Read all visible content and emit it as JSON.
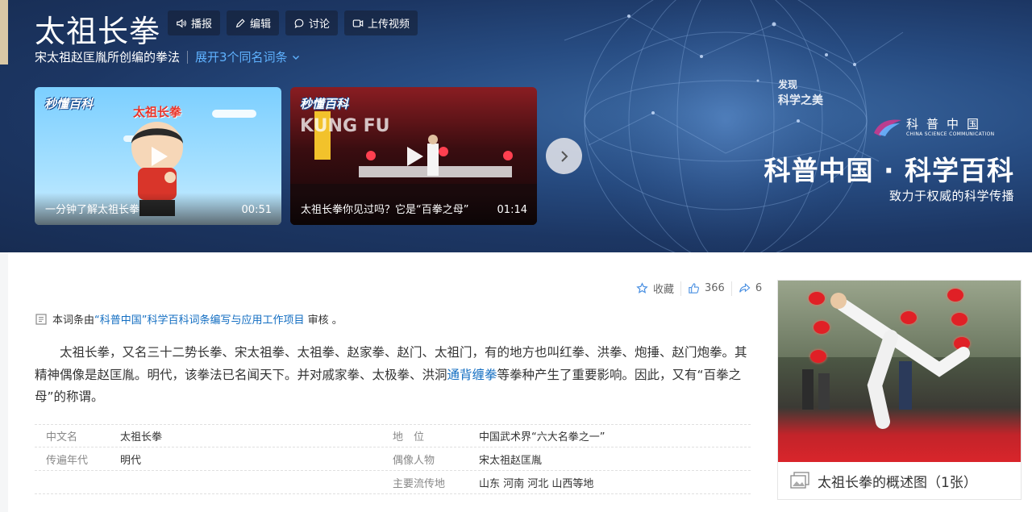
{
  "header": {
    "title": "太祖长拳",
    "actions": [
      {
        "label": "播报",
        "icon": "speaker-icon"
      },
      {
        "label": "编辑",
        "icon": "pencil-icon"
      },
      {
        "label": "讨论",
        "icon": "chat-icon"
      },
      {
        "label": "上传视频",
        "icon": "video-upload-icon"
      }
    ],
    "subtitle": "宋太祖赵匡胤所创编的拳法",
    "expand_label": "展开3个同名词条"
  },
  "videos": [
    {
      "brand": "秒懂百科",
      "overlay_title": "太祖长拳",
      "caption": "一分钟了解太祖长拳",
      "duration": "00:51"
    },
    {
      "brand": "秒懂百科",
      "overlay_title": "KUNG FU",
      "caption": "太祖长拳你见过吗？它是“百拳之母”",
      "duration": "01:14"
    }
  ],
  "promo": {
    "discover_label": "发现",
    "discover_sub": "科学之美",
    "logo_cn": "科普中国",
    "logo_en": "CHINA SCIENCE COMMUNICATION",
    "slogan": "科普中国 · 科学百科",
    "tagline": "致力于权威的科学传播"
  },
  "toolbar": {
    "favorite_label": "收藏",
    "like_count": "366",
    "share_count": "6"
  },
  "notice": {
    "prefix": "本词条由",
    "link": "“科普中国”科学百科词条编写与应用工作项目",
    "suffix": " 审核 。"
  },
  "article": {
    "text_before_link": "太祖长拳，又名三十二势长拳、宋太祖拳、太祖拳、赵家拳、赵门、太祖门，有的地方也叫红拳、洪拳、炮捶、赵门炮拳。其精神偶像是赵匡胤。明代，该拳法已名闻天下。并对戚家拳、太极拳、洪洞",
    "link": "通背缠拳",
    "text_after_link": "等拳种产生了重要影响。因此，又有“百拳之母”的称谓。"
  },
  "infobox": {
    "rows": [
      [
        {
          "k": "中文名",
          "v": "太祖长拳"
        },
        {
          "k": "地　位",
          "v": "中国武术界“六大名拳之一”"
        }
      ],
      [
        {
          "k": "传遍年代",
          "v": "明代"
        },
        {
          "k": "偶像人物",
          "v": "宋太祖赵匡胤"
        }
      ],
      [
        {
          "k": "",
          "v": ""
        },
        {
          "k": "主要流传地",
          "v": "山东 河南 河北 山西等地"
        }
      ]
    ]
  },
  "sidebar": {
    "caption": "太祖长拳的概述图（1张）"
  },
  "colors": {
    "link_blue": "#136ec2",
    "expand_blue": "#5fb2ff",
    "banner_dark": "#1c3663"
  }
}
